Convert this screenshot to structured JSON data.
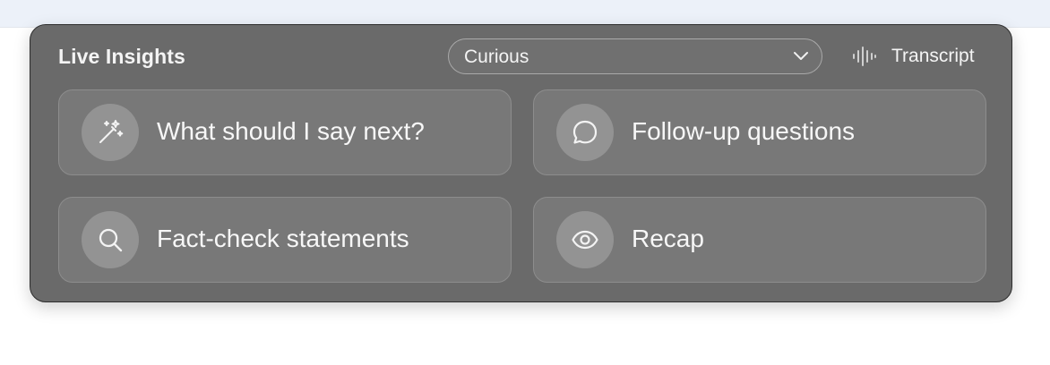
{
  "panel": {
    "title": "Live Insights",
    "mode_select": {
      "value": "Curious",
      "icon": "chevron-down-icon"
    },
    "transcript_button": {
      "label": "Transcript",
      "icon": "audio-waveform-icon"
    },
    "actions": [
      {
        "label": "What should I say next?",
        "icon": "magic-wand-icon"
      },
      {
        "label": "Follow-up questions",
        "icon": "chat-bubble-icon"
      },
      {
        "label": "Fact-check statements",
        "icon": "search-icon"
      },
      {
        "label": "Recap",
        "icon": "eye-icon"
      }
    ]
  },
  "colors": {
    "panel_background": "#6a6a6a",
    "card_background": "#787878",
    "icon_circle": "#939393",
    "text": "#f4f4f4",
    "top_bar": "#ecf1f9"
  }
}
